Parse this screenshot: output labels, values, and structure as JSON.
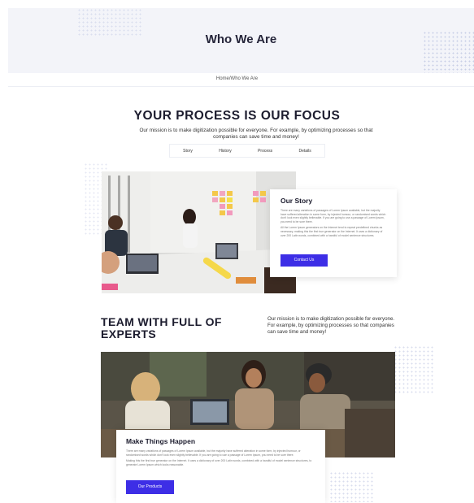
{
  "hero": {
    "title": "Who We Are"
  },
  "breadcrumb": "Home/Who We Are",
  "focus": {
    "title": "YOUR PROCESS IS OUR FOCUS",
    "description": "Our mission is to make digitization possible for everyone. For example, by optimizing processes so that companies can save time and money!",
    "tabs": [
      "Story",
      "History",
      "Process",
      "Details"
    ]
  },
  "story": {
    "title": "Our Story",
    "paragraph1": "There are many variations of passages of Lorem Ipsum available, but the majority have suffered alteration in some form, by injected humour, or randomised words which don't look even slightly believable. If you are going to use a passage of Lorem Ipsum, you need to be sure there.",
    "paragraph2": "All the Lorem Ipsum generators on the Internet tend to repeat predefined chunks as necessary, making this the first true generator on the Internet. It uses a dictionary of over 200 Latin words, combined with a handful of model sentence structures.",
    "button": "Contact Us"
  },
  "team": {
    "title": "TEAM WITH FULL OF EXPERTS",
    "description": "Our mission is to make digitization possible for everyone. For example, by optimizing processes so that companies can save time and money!"
  },
  "things": {
    "title": "Make Things Happen",
    "paragraph1": "There are many variations of passages of Lorem Ipsum available, but the majority have suffered alteration in some form, by injected humour, or randomised words which don't look even slightly believable. If you are going to use a passage of Lorem Ipsum, you need to be sure there.",
    "paragraph2": "Making this the first true generator on the Internet. It uses a dictionary of over 200 Latin words, combined with a handful of model sentence structures, to generate Lorem Ipsum which looks reasonable.",
    "button": "Our Products"
  },
  "colors": {
    "accent": "#3d2ee6",
    "hero_bg": "#f3f4f9",
    "heading": "#1c1c2e"
  }
}
